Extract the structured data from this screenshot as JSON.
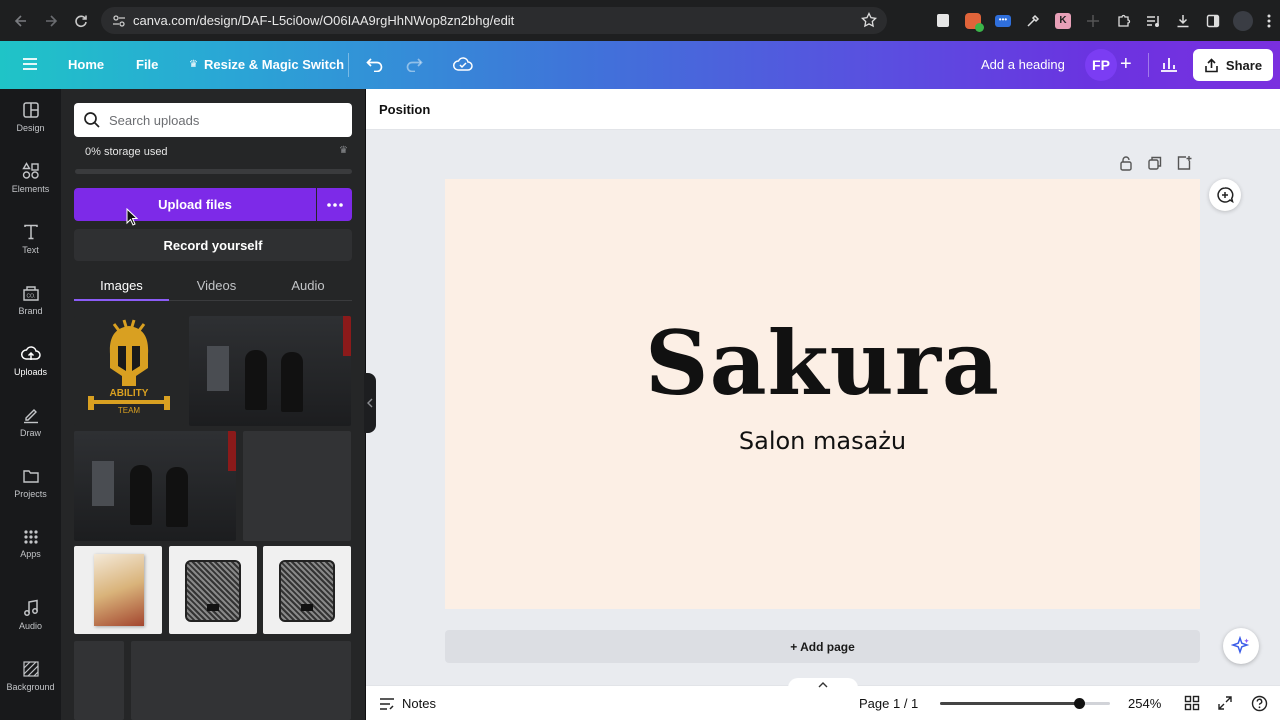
{
  "browser": {
    "url": "canva.com/design/DAF-L5ci0ow/O06IAA9rgHhNWop8zn2bhg/edit"
  },
  "topbar": {
    "home": "Home",
    "file": "File",
    "resize": "Resize & Magic Switch",
    "add_heading": "Add a heading",
    "avatar_initials": "FP",
    "share": "Share"
  },
  "rail": [
    {
      "label": "Design",
      "icon": "design-icon"
    },
    {
      "label": "Elements",
      "icon": "elements-icon"
    },
    {
      "label": "Text",
      "icon": "text-icon"
    },
    {
      "label": "Brand",
      "icon": "brand-icon"
    },
    {
      "label": "Uploads",
      "icon": "uploads-icon"
    },
    {
      "label": "Draw",
      "icon": "draw-icon"
    },
    {
      "label": "Projects",
      "icon": "projects-icon"
    },
    {
      "label": "Apps",
      "icon": "apps-icon"
    },
    {
      "label": "Audio",
      "icon": "audio-icon"
    },
    {
      "label": "Background",
      "icon": "background-icon"
    }
  ],
  "panel": {
    "search_placeholder": "Search uploads",
    "storage": "0% storage used",
    "upload_files": "Upload files",
    "record_yourself": "Record yourself",
    "tabs": [
      "Images",
      "Videos",
      "Audio"
    ],
    "logo_text_1": "ABILITY",
    "logo_text_2": "TEAM"
  },
  "editor": {
    "context_label": "Position",
    "canvas_title": "Sakura",
    "canvas_subtitle": "Salon masażu",
    "add_page": "+ Add page",
    "notes": "Notes",
    "page_indicator": "Page 1 / 1",
    "zoom": "254%",
    "zoom_level_fraction": 0.82
  },
  "colors": {
    "accent": "#7d2ae8",
    "canvas_bg": "#fcefe5",
    "panel_bg": "#252627"
  }
}
